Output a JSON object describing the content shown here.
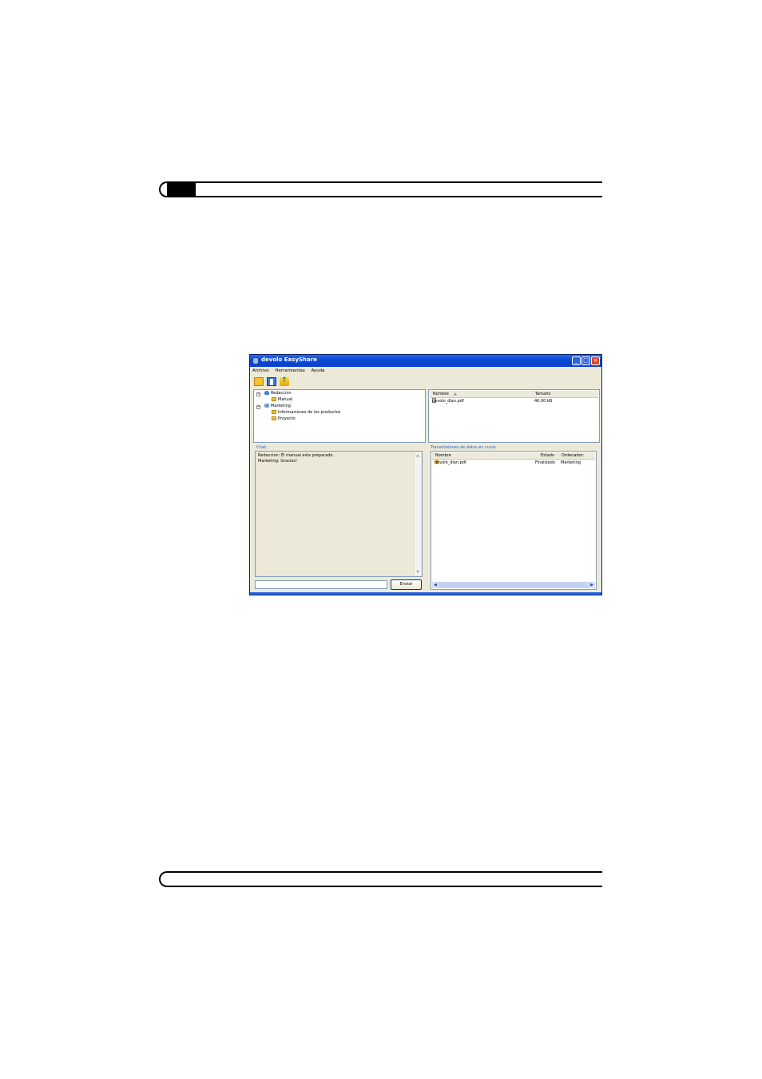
{
  "window": {
    "title": "devolo EasyShare",
    "menu": [
      "Archivo",
      "Herramientas",
      "Ayuda"
    ]
  },
  "tree": {
    "groups": [
      {
        "label": "Redaccion",
        "icon": "user-icon",
        "children": [
          "Manual"
        ]
      },
      {
        "label": "Marketing",
        "icon": "group-icon",
        "children": [
          "Informaciones de los productos",
          "Proyecto"
        ]
      }
    ]
  },
  "files": {
    "columns": [
      "Nombre",
      "Tamaño"
    ],
    "rows": [
      {
        "name": "devolo_dlan.pdf",
        "size": "46.00 kB"
      }
    ]
  },
  "chat": {
    "label": "Chat:",
    "messages": [
      "Redaccion: El manual esta preparado.",
      "Marketing: Gracias!"
    ],
    "send_label": "Enviar"
  },
  "transfers": {
    "label": "Transmisiones de datos en curso",
    "columns": [
      "Nombre",
      "Estado",
      "Ordenador:"
    ],
    "rows": [
      {
        "name": "devolo_dlan.pdf",
        "status": "Finalizado",
        "computer": "Marketing"
      }
    ]
  }
}
